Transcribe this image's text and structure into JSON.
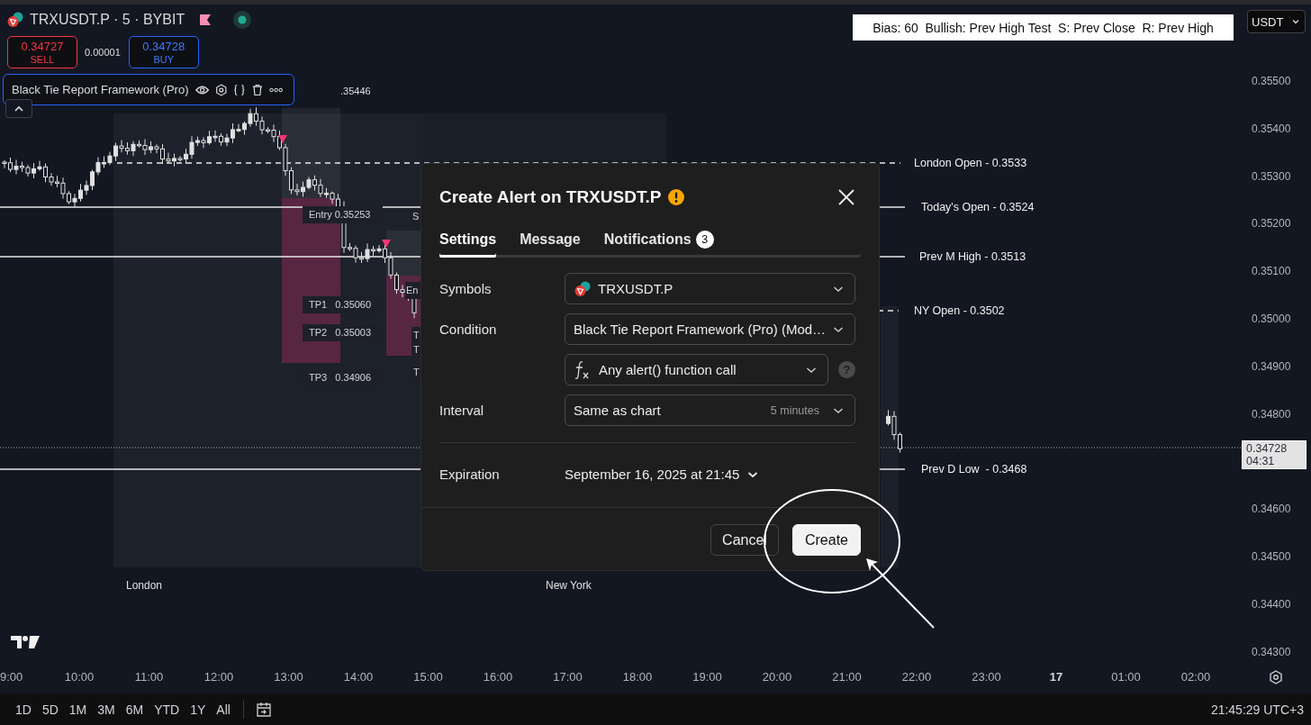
{
  "chart_header": {
    "symbol": "TRXUSDT.P · 5 · BYBIT"
  },
  "trade_buttons": {
    "sell": {
      "price": "0.34727",
      "label": "SELL"
    },
    "spread": "0.00001",
    "buy": {
      "price": "0.34728",
      "label": "BUY"
    }
  },
  "indicator_legend": {
    "name": "Black Tie Report Framework (Pro)",
    "selected": true
  },
  "high_marker": ".35446",
  "bias_box": "Bias: 60  Bullish: Prev High Test  S: Prev Close  R: Prev High",
  "currency_select": "USDT",
  "levels": [
    {
      "label": "London Open - 0.3533",
      "kind": "dashed"
    },
    {
      "label": "Today's Open - 0.3524",
      "kind": "solid"
    },
    {
      "label": "Prev M High - 0.3513",
      "kind": "solid"
    },
    {
      "label": "NY Open - 0.3502",
      "kind": "dashed"
    },
    {
      "label": "Prev D Low  - 0.3468",
      "kind": "solid"
    }
  ],
  "trade_labels": [
    {
      "text": "Entry 0.35253"
    },
    {
      "text": "TP1   0.35060"
    },
    {
      "text": "TP2   0.35003"
    },
    {
      "text": "TP3   0.34906"
    },
    {
      "text": "S"
    },
    {
      "text": "En"
    },
    {
      "text": "T"
    },
    {
      "text": "T"
    },
    {
      "text": "T"
    }
  ],
  "sessions": [
    "London",
    "New York"
  ],
  "price_axis": [
    "0.35500",
    "0.35400",
    "0.35300",
    "0.35200",
    "0.35100",
    "0.35000",
    "0.34900",
    "0.34800",
    "0.34600",
    "0.34500",
    "0.34400",
    "0.34300"
  ],
  "last_price": {
    "price": "0.34728",
    "countdown": "04:31"
  },
  "time_axis": [
    {
      "label": "9:00",
      "kind": "time"
    },
    {
      "label": "10:00",
      "kind": "time"
    },
    {
      "label": "11:00",
      "kind": "time"
    },
    {
      "label": "12:00",
      "kind": "time"
    },
    {
      "label": "13:00",
      "kind": "time"
    },
    {
      "label": "14:00",
      "kind": "time"
    },
    {
      "label": "15:00",
      "kind": "time"
    },
    {
      "label": "16:00",
      "kind": "time"
    },
    {
      "label": "17:00",
      "kind": "time"
    },
    {
      "label": "18:00",
      "kind": "time"
    },
    {
      "label": "19:00",
      "kind": "time"
    },
    {
      "label": "20:00",
      "kind": "time"
    },
    {
      "label": "21:00",
      "kind": "time"
    },
    {
      "label": "22:00",
      "kind": "time"
    },
    {
      "label": "23:00",
      "kind": "time"
    },
    {
      "label": "17",
      "kind": "day"
    },
    {
      "label": "01:00",
      "kind": "time"
    },
    {
      "label": "02:00",
      "kind": "time"
    }
  ],
  "ranges": [
    "1D",
    "5D",
    "1M",
    "3M",
    "6M",
    "YTD",
    "1Y",
    "All"
  ],
  "clock": "21:45:29 UTC+3",
  "dialog": {
    "title": "Create Alert on TRXUSDT.P",
    "tabs": [
      {
        "label": "Settings",
        "selected": true
      },
      {
        "label": "Message",
        "selected": false
      },
      {
        "label": "Notifications",
        "selected": false,
        "badge": "3"
      }
    ],
    "symbols": {
      "label": "Symbols",
      "value": "TRXUSDT.P"
    },
    "condition": {
      "label": "Condition",
      "value": "Black Tie Report Framework (Pro) (Mod…",
      "function": "Any alert() function call",
      "help": "?"
    },
    "interval": {
      "label": "Interval",
      "value": "Same as chart",
      "hint": "5 minutes"
    },
    "expiration": {
      "label": "Expiration",
      "value": "September 16, 2025 at 21:45"
    },
    "buttons": [
      "Cancel",
      "Create"
    ]
  }
}
